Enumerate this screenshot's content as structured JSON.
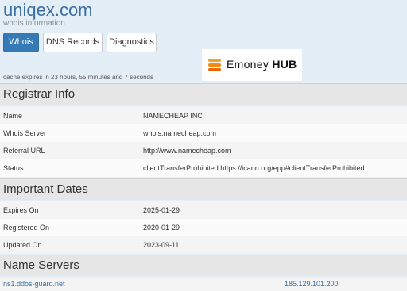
{
  "site": {
    "title": "uniqex.com",
    "subtitle": "whois information"
  },
  "tabs": [
    {
      "label": "Whois",
      "active": true
    },
    {
      "label": "DNS Records",
      "active": false
    },
    {
      "label": "Diagnostics",
      "active": false
    }
  ],
  "cache_text": "cache expires in 23 hours, 55 minutes and 7 seconds",
  "ad": {
    "text_regular": "Emoney ",
    "text_bold": "HUB",
    "logo_icon": "emoney-hub-logo-icon"
  },
  "registrar": {
    "heading": "Registrar Info",
    "rows": [
      {
        "key": "Name",
        "value": "NAMECHEAP INC"
      },
      {
        "key": "Whois Server",
        "value": "whois.namecheap.com"
      },
      {
        "key": "Referral URL",
        "value": "http://www.namecheap.com"
      },
      {
        "key": "Status",
        "value": "clientTransferProhibited https://icann.org/epp#clientTransferProhibited"
      }
    ]
  },
  "dates": {
    "heading": "Important Dates",
    "rows": [
      {
        "key": "Expires On",
        "value": "2025-01-29"
      },
      {
        "key": "Registered On",
        "value": "2020-01-29"
      },
      {
        "key": "Updated On",
        "value": "2023-09-11"
      }
    ]
  },
  "name_servers": {
    "heading": "Name Servers",
    "rows": [
      {
        "host": "ns1.ddos-guard.net",
        "ip": "185.129.101.200"
      }
    ]
  },
  "colors": {
    "accent": "#337ab7",
    "link": "#3a6ea5",
    "header_bg": "#e3eef6"
  }
}
